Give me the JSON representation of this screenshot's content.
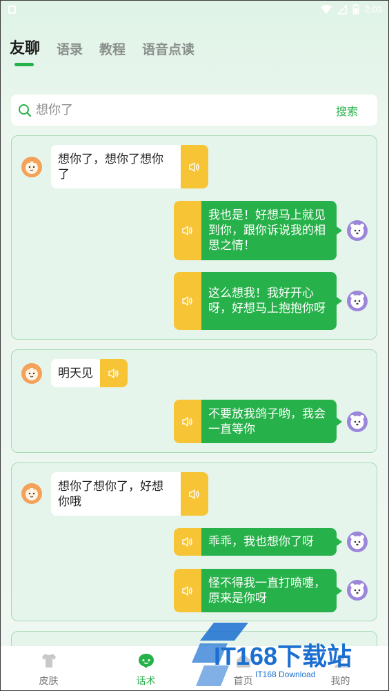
{
  "status_bar": {
    "time": "2:03"
  },
  "tabs": [
    {
      "label": "友聊",
      "active": true
    },
    {
      "label": "语录",
      "active": false
    },
    {
      "label": "教程",
      "active": false
    },
    {
      "label": "语音点读",
      "active": false
    }
  ],
  "search": {
    "value": "",
    "placeholder": "想你了",
    "button_label": "搜索"
  },
  "cards": [
    {
      "them": [
        "想你了，想你了想你了"
      ],
      "me": [
        "我也是！好想马上就见到你，跟你诉说我的相思之情！",
        "这么想我！我好开心呀，好想马上抱抱你呀"
      ]
    },
    {
      "them": [
        "明天见"
      ],
      "me": [
        "不要放我鸽子哟，我会一直等你"
      ]
    },
    {
      "them": [
        "想你了想你了，好想你哦"
      ],
      "me": [
        "乖乖，我也想你了呀",
        "怪不得我一直打喷嚏，原来是你呀"
      ]
    }
  ],
  "bottom_nav": [
    {
      "label": "皮肤",
      "icon": "shirt-icon",
      "active": false
    },
    {
      "label": "话术",
      "icon": "chat-bubble-icon",
      "active": true
    },
    {
      "label": "首页",
      "icon": "home-icon",
      "active": false
    },
    {
      "label": "我的",
      "icon": "user-icon",
      "active": false
    }
  ],
  "watermark": {
    "text": "IT168下载站",
    "sub": "IT168 Download"
  },
  "colors": {
    "green": "#27b14a",
    "yellow": "#f7c436",
    "card_bg": "#e6f5eb",
    "card_border": "#a8dab5",
    "avatar_orange": "#f4a15a",
    "avatar_purple": "#9b86d9"
  }
}
